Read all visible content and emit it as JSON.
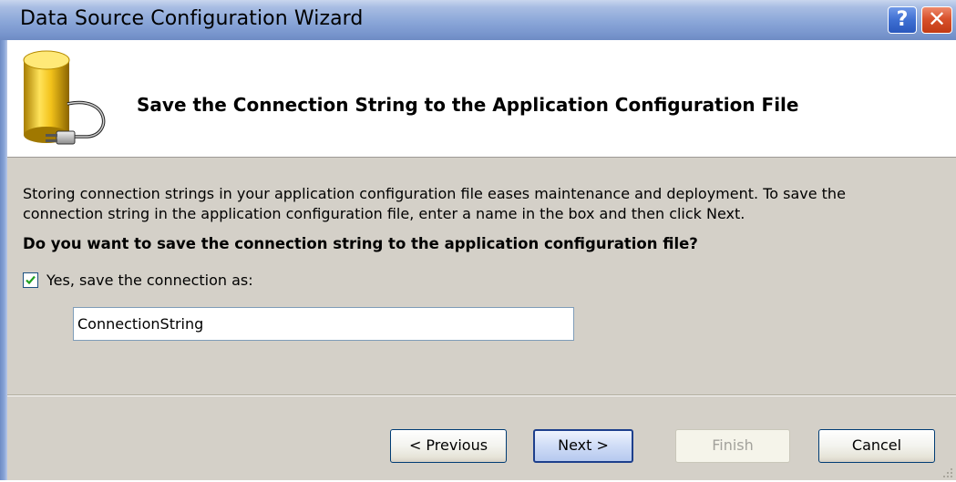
{
  "window": {
    "title": "Data Source Configuration Wizard",
    "help_glyph": "?",
    "close_glyph": "✕"
  },
  "header": {
    "title": "Save the Connection String to the Application Configuration File",
    "icon": "database-plug-icon"
  },
  "body": {
    "description_line1": "Storing connection strings in your application configuration file eases maintenance and deployment. To save the",
    "description_line2": "connection string in the application configuration file, enter a name in the box and then click Next.",
    "question": "Do you want to save the connection string to the application configuration file?",
    "checkbox_label": "Yes, save the connection as:",
    "checkbox_checked": true,
    "connection_name_value": "ConnectionString"
  },
  "footer": {
    "previous_label": "< Previous",
    "next_label": "Next >",
    "finish_label": "Finish",
    "cancel_label": "Cancel"
  },
  "colors": {
    "titlebar": "#8aa6d8",
    "close_button": "#d8512c",
    "help_button": "#3e6fd2",
    "dialog_body": "#d4d0c8"
  }
}
